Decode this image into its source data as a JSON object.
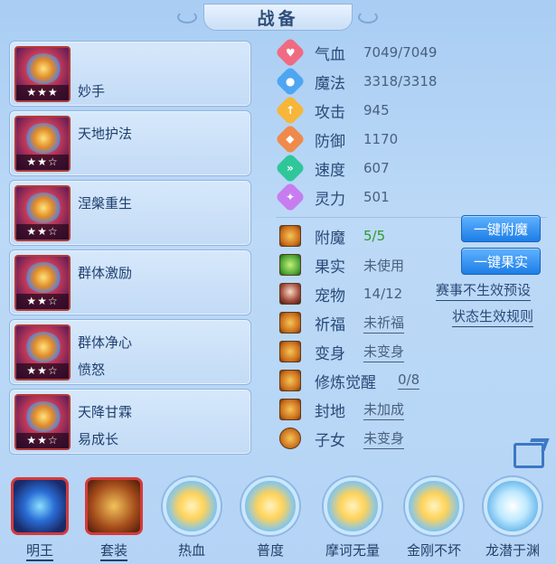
{
  "header": {
    "title": "战备"
  },
  "skills": [
    {
      "line1": "",
      "line2": "妙手",
      "stars": "★★★"
    },
    {
      "line1": "天地护法",
      "line2": "",
      "stars": "★★☆"
    },
    {
      "line1": "涅槃重生",
      "line2": "",
      "stars": "★★☆"
    },
    {
      "line1": "群体激励",
      "line2": "",
      "stars": "★★☆"
    },
    {
      "line1": "群体净心",
      "line2": "愤怒",
      "stars": "★★☆"
    },
    {
      "line1": "天降甘霖",
      "line2": "易成长",
      "stars": "★★☆"
    }
  ],
  "stats": [
    {
      "icon": "heart-icon",
      "color": "#f06b82",
      "glyph": "♥",
      "label": "气血",
      "value": "7049/7049"
    },
    {
      "icon": "magic-icon",
      "color": "#4ea6f2",
      "glyph": "●",
      "label": "魔法",
      "value": "3318/3318"
    },
    {
      "icon": "attack-icon",
      "color": "#f5b63a",
      "glyph": "↑",
      "label": "攻击",
      "value": "945"
    },
    {
      "icon": "defense-icon",
      "color": "#f08a4a",
      "glyph": "◆",
      "label": "防御",
      "value": "1170"
    },
    {
      "icon": "speed-icon",
      "color": "#2fc79a",
      "glyph": "»",
      "label": "速度",
      "value": "607"
    },
    {
      "icon": "spirit-icon",
      "color": "#c77df0",
      "glyph": "✦",
      "label": "灵力",
      "value": "501"
    }
  ],
  "extras": {
    "enchant": {
      "label": "附魔",
      "value": "5/5"
    },
    "fruit": {
      "label": "果实",
      "value": "未使用"
    },
    "pet": {
      "label": "宠物",
      "value": "14/12"
    },
    "blessing": {
      "label": "祈福",
      "value": "未祈福"
    },
    "transform": {
      "label": "变身",
      "value": "未变身"
    },
    "cultivation": {
      "label": "修炼觉醒",
      "value": "0/8"
    },
    "territory": {
      "label": "封地",
      "value": "未加成"
    },
    "children": {
      "label": "子女",
      "value": "未变身"
    }
  },
  "buttons": {
    "enchant_all": "一键附魔",
    "fruit_all": "一键果实",
    "event_preset": "赛事不生效预设",
    "status_rules": "状态生效规则"
  },
  "bottom_bar": [
    {
      "label": "明王",
      "underlined": true
    },
    {
      "label": "套装",
      "underlined": true
    },
    {
      "label": "热血",
      "underlined": false
    },
    {
      "label": "普度",
      "underlined": false
    },
    {
      "label": "摩诃无量",
      "underlined": false
    },
    {
      "label": "金刚不坏",
      "underlined": false
    },
    {
      "label": "龙潜于渊",
      "underlined": false
    }
  ]
}
